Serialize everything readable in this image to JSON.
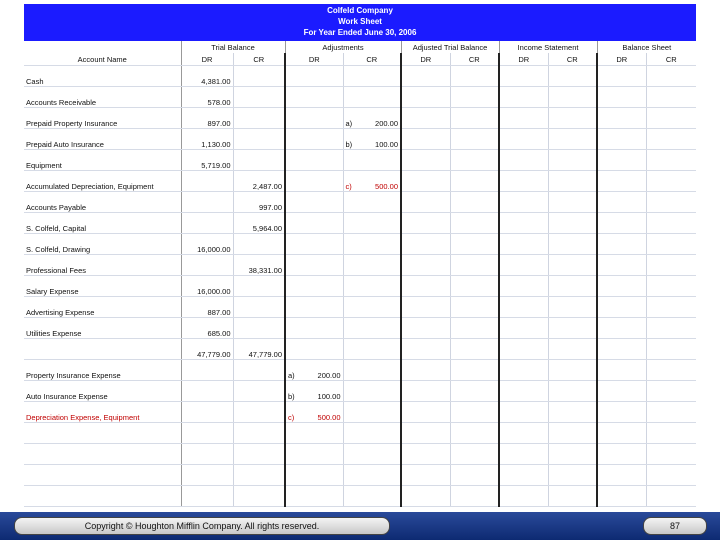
{
  "header": {
    "company": "Colfeld Company",
    "doc_title": "Work Sheet",
    "period": "For Year Ended June 30, 2006"
  },
  "columns": {
    "account_name": "Account Name",
    "groups": [
      "Trial Balance",
      "Adjustments",
      "Adjusted Trial Balance",
      "Income Statement",
      "Balance Sheet"
    ],
    "dr": "DR",
    "cr": "CR"
  },
  "rows": [
    {
      "name": "Cash",
      "tb_dr": "4,381.00",
      "tb_cr": "",
      "adj_dr_key": "",
      "adj_dr": "",
      "adj_cr_key": "",
      "adj_cr": "",
      "red": false
    },
    {
      "name": "Accounts Receivable",
      "tb_dr": "578.00",
      "tb_cr": "",
      "adj_dr_key": "",
      "adj_dr": "",
      "adj_cr_key": "",
      "adj_cr": "",
      "red": false
    },
    {
      "name": "Prepaid Property Insurance",
      "tb_dr": "897.00",
      "tb_cr": "",
      "adj_dr_key": "",
      "adj_dr": "",
      "adj_cr_key": "a)",
      "adj_cr": "200.00",
      "red": false
    },
    {
      "name": "Prepaid Auto Insurance",
      "tb_dr": "1,130.00",
      "tb_cr": "",
      "adj_dr_key": "",
      "adj_dr": "",
      "adj_cr_key": "b)",
      "adj_cr": "100.00",
      "red": false
    },
    {
      "name": "Equipment",
      "tb_dr": "5,719.00",
      "tb_cr": "",
      "adj_dr_key": "",
      "adj_dr": "",
      "adj_cr_key": "",
      "adj_cr": "",
      "red": false
    },
    {
      "name": "Accumulated Depreciation, Equipment",
      "tb_dr": "",
      "tb_cr": "2,487.00",
      "adj_dr_key": "",
      "adj_dr": "",
      "adj_cr_key": "c)",
      "adj_cr": "500.00",
      "red": false,
      "adj_red": true
    },
    {
      "name": "Accounts Payable",
      "tb_dr": "",
      "tb_cr": "997.00",
      "adj_dr_key": "",
      "adj_dr": "",
      "adj_cr_key": "",
      "adj_cr": "",
      "red": false
    },
    {
      "name": "S. Colfeld, Capital",
      "tb_dr": "",
      "tb_cr": "5,964.00",
      "adj_dr_key": "",
      "adj_dr": "",
      "adj_cr_key": "",
      "adj_cr": "",
      "red": false
    },
    {
      "name": "S. Colfeld, Drawing",
      "tb_dr": "16,000.00",
      "tb_cr": "",
      "adj_dr_key": "",
      "adj_dr": "",
      "adj_cr_key": "",
      "adj_cr": "",
      "red": false
    },
    {
      "name": "Professional Fees",
      "tb_dr": "",
      "tb_cr": "38,331.00",
      "adj_dr_key": "",
      "adj_dr": "",
      "adj_cr_key": "",
      "adj_cr": "",
      "red": false
    },
    {
      "name": "Salary Expense",
      "tb_dr": "16,000.00",
      "tb_cr": "",
      "adj_dr_key": "",
      "adj_dr": "",
      "adj_cr_key": "",
      "adj_cr": "",
      "red": false
    },
    {
      "name": "Advertising Expense",
      "tb_dr": "887.00",
      "tb_cr": "",
      "adj_dr_key": "",
      "adj_dr": "",
      "adj_cr_key": "",
      "adj_cr": "",
      "red": false
    },
    {
      "name": "Utilities Expense",
      "tb_dr": "685.00",
      "tb_cr": "",
      "adj_dr_key": "",
      "adj_dr": "",
      "adj_cr_key": "",
      "adj_cr": "",
      "red": false
    },
    {
      "name": "",
      "tb_dr": "47,779.00",
      "tb_cr": "47,779.00",
      "adj_dr_key": "",
      "adj_dr": "",
      "adj_cr_key": "",
      "adj_cr": "",
      "red": false,
      "total": true
    },
    {
      "name": "Property Insurance Expense",
      "tb_dr": "",
      "tb_cr": "",
      "adj_dr_key": "a)",
      "adj_dr": "200.00",
      "adj_cr_key": "",
      "adj_cr": "",
      "red": false
    },
    {
      "name": "Auto Insurance Expense",
      "tb_dr": "",
      "tb_cr": "",
      "adj_dr_key": "b)",
      "adj_dr": "100.00",
      "adj_cr_key": "",
      "adj_cr": "",
      "red": false
    },
    {
      "name": "Depreciation Expense, Equipment",
      "tb_dr": "",
      "tb_cr": "",
      "adj_dr_key": "c)",
      "adj_dr": "500.00",
      "adj_cr_key": "",
      "adj_cr": "",
      "red": true
    },
    {
      "name": "",
      "tb_dr": "",
      "tb_cr": "",
      "adj_dr_key": "",
      "adj_dr": "",
      "adj_cr_key": "",
      "adj_cr": "",
      "red": false
    },
    {
      "name": "",
      "tb_dr": "",
      "tb_cr": "",
      "adj_dr_key": "",
      "adj_dr": "",
      "adj_cr_key": "",
      "adj_cr": "",
      "red": false
    },
    {
      "name": "",
      "tb_dr": "",
      "tb_cr": "",
      "adj_dr_key": "",
      "adj_dr": "",
      "adj_cr_key": "",
      "adj_cr": "",
      "red": false
    },
    {
      "name": "",
      "tb_dr": "",
      "tb_cr": "",
      "adj_dr_key": "",
      "adj_dr": "",
      "adj_cr_key": "",
      "adj_cr": "",
      "red": false
    }
  ],
  "footer": {
    "copyright": "Copyright © Houghton Mifflin Company. All rights reserved.",
    "page_number": "87"
  },
  "colors": {
    "title_bar": "#1b1bff",
    "footer_bar": "#0d2a72",
    "red_text": "#c00000"
  }
}
